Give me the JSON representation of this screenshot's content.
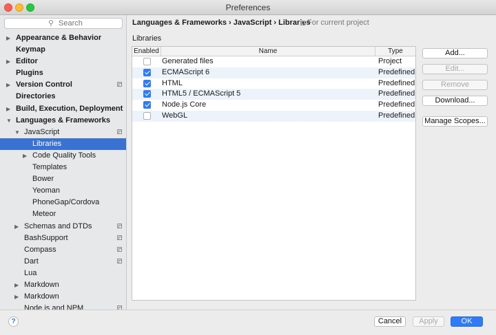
{
  "window": {
    "title": "Preferences"
  },
  "search": {
    "placeholder": "Search"
  },
  "sidebar": {
    "items": [
      {
        "label": "Appearance & Behavior",
        "bold": true,
        "arrow": "right",
        "level": 0
      },
      {
        "label": "Keymap",
        "bold": true,
        "level": 0
      },
      {
        "label": "Editor",
        "bold": true,
        "arrow": "right",
        "level": 0
      },
      {
        "label": "Plugins",
        "bold": true,
        "level": 0
      },
      {
        "label": "Version Control",
        "bold": true,
        "arrow": "right",
        "level": 0,
        "copy": true
      },
      {
        "label": "Directories",
        "bold": true,
        "level": 0
      },
      {
        "label": "Build, Execution, Deployment",
        "bold": true,
        "arrow": "right",
        "level": 0
      },
      {
        "label": "Languages & Frameworks",
        "bold": true,
        "arrow": "down",
        "level": 0
      },
      {
        "label": "JavaScript",
        "arrow": "down",
        "level": 1,
        "copy": true
      },
      {
        "label": "Libraries",
        "level": 2,
        "selected": true
      },
      {
        "label": "Code Quality Tools",
        "arrow": "right",
        "level": 2
      },
      {
        "label": "Templates",
        "level": 2
      },
      {
        "label": "Bower",
        "level": 2
      },
      {
        "label": "Yeoman",
        "level": 2
      },
      {
        "label": "PhoneGap/Cordova",
        "level": 2
      },
      {
        "label": "Meteor",
        "level": 2
      },
      {
        "label": "Schemas and DTDs",
        "arrow": "right",
        "level": 1,
        "copy": true
      },
      {
        "label": "BashSupport",
        "level": 1,
        "copy": true
      },
      {
        "label": "Compass",
        "level": 1,
        "copy": true
      },
      {
        "label": "Dart",
        "level": 1,
        "copy": true
      },
      {
        "label": "Lua",
        "level": 1
      },
      {
        "label": "Markdown",
        "arrow": "right",
        "level": 1
      },
      {
        "label": "Markdown",
        "arrow": "right",
        "level": 1
      },
      {
        "label": "Node.js and NPM",
        "level": 1,
        "copy": true
      }
    ]
  },
  "breadcrumb": "Languages & Frameworks › JavaScript › Libraries",
  "scope_note": "For current project",
  "section_label": "Libraries",
  "table": {
    "headers": [
      "Enabled",
      "Name",
      "Type"
    ],
    "rows": [
      {
        "enabled": false,
        "name": "Generated files",
        "type": "Project"
      },
      {
        "enabled": true,
        "name": "ECMAScript 6",
        "type": "Predefined"
      },
      {
        "enabled": true,
        "name": "HTML",
        "type": "Predefined"
      },
      {
        "enabled": true,
        "name": "HTML5 / ECMAScript 5",
        "type": "Predefined"
      },
      {
        "enabled": true,
        "name": "Node.js Core",
        "type": "Predefined"
      },
      {
        "enabled": false,
        "name": "WebGL",
        "type": "Predefined"
      }
    ]
  },
  "buttons": {
    "add": "Add...",
    "edit": "Edit...",
    "remove": "Remove",
    "download": "Download...",
    "manage_scopes": "Manage Scopes..."
  },
  "footer": {
    "help": "?",
    "cancel": "Cancel",
    "apply": "Apply",
    "ok": "OK"
  },
  "colors": {
    "accent": "#3a72d4",
    "checkbox": "#2f7cf6",
    "ok_button": "#2f7cf6"
  }
}
